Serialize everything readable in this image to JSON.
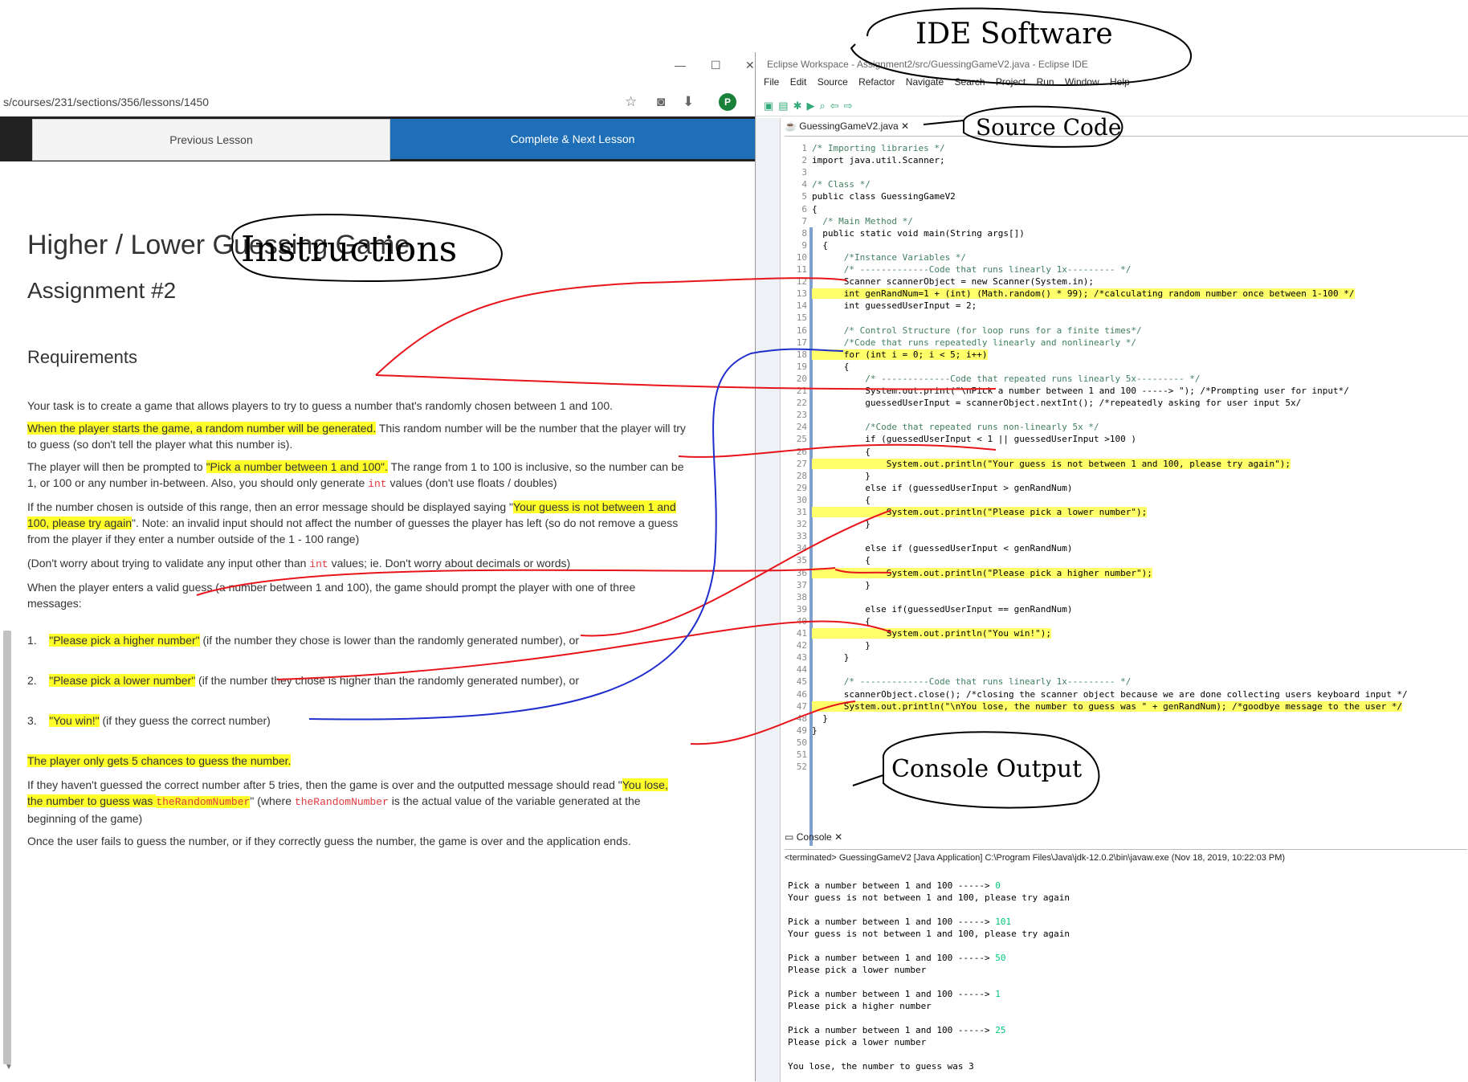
{
  "browser": {
    "window_controls": [
      "—",
      "☐",
      "✕"
    ],
    "url": "s/courses/231/sections/356/lessons/1450",
    "avatar_letter": "P",
    "prev_label": "Previous Lesson",
    "next_label": "Complete & Next Lesson"
  },
  "lesson": {
    "title": "Higher / Lower Guessing Game",
    "subtitle": "Assignment #2",
    "requirements": "Requirements",
    "p1": "Your task is to create a game that allows players to try to guess a number that's randomly chosen between 1 and 100.",
    "p2_hl": "When the player starts the game, a random number will be generated.",
    "p2_rest": " This random number will be the number that the player will try to guess (so don't tell the player what this number is).",
    "p3_a": "The player will then be prompted to ",
    "p3_hl": "\"Pick a number between 1 and 100\".",
    "p3_b": " The range from 1 to 100 is inclusive, so the number can be 1, or 100 or any number in-between. Also, you should only generate ",
    "p3_code": "int",
    "p3_c": " values (don't use floats / doubles)",
    "p4_a": "If the number chosen is outside of this range, then an error message should be displayed saying \"",
    "p4_hl": "Your guess is not between 1 and 100, please try again",
    "p4_b": "\". Note: an invalid input should not affect the number of guesses the player has left (so do not remove a guess from the player if they enter a number outside of the 1 - 100 range)",
    "p5_a": "(Don't worry about trying to validate any input other than ",
    "p5_code": "int",
    "p5_b": " values; ie. Don't worry about decimals or words)",
    "p6": "When the player enters a valid guess (a number between 1 and 100), the game should prompt the player with one of three messages:",
    "li1_num": "1.",
    "li1_hl": "\"Please pick a higher number\"",
    "li1_rest": " (if the number they chose is lower than the randomly generated number), or",
    "li2_num": "2.",
    "li2_hl": "\"Please pick a lower number\"",
    "li2_rest": " (if the number they chose is higher than the randomly generated number), or",
    "li3_num": "3.",
    "li3_hl": "\"You win!\"",
    "li3_rest": " (if they guess the correct number)",
    "p7_hl": "The player only gets 5 chances to guess the number.",
    "p8_a": "If they haven't guessed the correct number after 5 tries, then the game is over and the outputted message should read \"",
    "p8_hl1": "You lose, the number to guess was ",
    "p8_code": "theRandomNumber",
    "p8_b": "\" (where ",
    "p8_code2": "theRandomNumber",
    "p8_c": " is the actual value of the variable generated at the beginning of the game)",
    "p9": "Once the user fails to guess the number, or if they correctly guess the number, the game is over and the application ends."
  },
  "eclipse": {
    "title": "Eclipse Workspace - Assignment2/src/GuessingGameV2.java - Eclipse IDE",
    "menu": [
      "File",
      "Edit",
      "Source",
      "Refactor",
      "Navigate",
      "Search",
      "Project",
      "Run",
      "Window",
      "Help"
    ],
    "editor_tab": "GuessingGameV2.java",
    "console_tab": "Console",
    "console_header": "<terminated> GuessingGameV2 [Java Application] C:\\Program Files\\Java\\jdk-12.0.2\\bin\\javaw.exe (Nov 18, 2019, 10:22:03 PM)"
  },
  "code": [
    {
      "n": "1",
      "t": "/* Importing libraries */"
    },
    {
      "n": "2",
      "t": "import java.util.Scanner;"
    },
    {
      "n": "3",
      "t": ""
    },
    {
      "n": "4",
      "t": "/* Class */"
    },
    {
      "n": "5",
      "t": "public class GuessingGameV2"
    },
    {
      "n": "6",
      "t": "{"
    },
    {
      "n": "7",
      "t": "  /* Main Method */"
    },
    {
      "n": "8",
      "t": "  public static void main(String args[])"
    },
    {
      "n": "9",
      "t": "  {"
    },
    {
      "n": "10",
      "t": "      /*Instance Variables */"
    },
    {
      "n": "11",
      "t": "      /* -------------Code that runs linearly 1x--------- */"
    },
    {
      "n": "12",
      "t": "      Scanner scannerObject = new Scanner(System.in);"
    },
    {
      "n": "13",
      "t": "      int genRandNum=1 + (int) (Math.random() * 99); /*calculating random number once between 1-100 */"
    },
    {
      "n": "14",
      "t": "      int guessedUserInput = 2;"
    },
    {
      "n": "15",
      "t": ""
    },
    {
      "n": "16",
      "t": "      /* Control Structure (for loop runs for a finite times*/"
    },
    {
      "n": "17",
      "t": "      /*Code that runs repeatedly linearly and nonlinearly */"
    },
    {
      "n": "18",
      "t": "      for (int i = 0; i < 5; i++)"
    },
    {
      "n": "19",
      "t": "      {"
    },
    {
      "n": "20",
      "t": "          /* -------------Code that repeated runs linearly 5x--------- */"
    },
    {
      "n": "21",
      "t": "          System.out.print(\"\\nPick a number between 1 and 100 -----> \"); /*Prompting user for input*/"
    },
    {
      "n": "22",
      "t": "          guessedUserInput = scannerObject.nextInt(); /*repeatedly asking for user input 5x/"
    },
    {
      "n": "23",
      "t": ""
    },
    {
      "n": "24",
      "t": "          /*Code that repeated runs non-linearly 5x */"
    },
    {
      "n": "25",
      "t": "          if (guessedUserInput < 1 || guessedUserInput >100 )"
    },
    {
      "n": "26",
      "t": "          {"
    },
    {
      "n": "27",
      "t": "              System.out.println(\"Your guess is not between 1 and 100, please try again\");"
    },
    {
      "n": "28",
      "t": "          }"
    },
    {
      "n": "29",
      "t": "          else if (guessedUserInput > genRandNum)"
    },
    {
      "n": "30",
      "t": "          {"
    },
    {
      "n": "31",
      "t": "              System.out.println(\"Please pick a lower number\");"
    },
    {
      "n": "32",
      "t": "          }"
    },
    {
      "n": "33",
      "t": ""
    },
    {
      "n": "34",
      "t": "          else if (guessedUserInput < genRandNum)"
    },
    {
      "n": "35",
      "t": "          {"
    },
    {
      "n": "36",
      "t": "              System.out.println(\"Please pick a higher number\");"
    },
    {
      "n": "37",
      "t": "          }"
    },
    {
      "n": "38",
      "t": ""
    },
    {
      "n": "39",
      "t": "          else if(guessedUserInput == genRandNum)"
    },
    {
      "n": "40",
      "t": "          {"
    },
    {
      "n": "41",
      "t": "              System.out.println(\"You win!\");"
    },
    {
      "n": "42",
      "t": "          }"
    },
    {
      "n": "43",
      "t": "      }"
    },
    {
      "n": "44",
      "t": ""
    },
    {
      "n": "45",
      "t": "      /* -------------Code that runs linearly 1x--------- */"
    },
    {
      "n": "46",
      "t": "      scannerObject.close(); /*closing the scanner object because we are done collecting users keyboard input */"
    },
    {
      "n": "47",
      "t": "      System.out.println(\"\\nYou lose, the number to guess was \" + genRandNum); /*goodbye message to the user */"
    },
    {
      "n": "48",
      "t": "  }"
    },
    {
      "n": "49",
      "t": "}"
    },
    {
      "n": "50",
      "t": ""
    },
    {
      "n": "51",
      "t": ""
    },
    {
      "n": "52",
      "t": ""
    }
  ],
  "console": [
    {
      "p": "Pick a number between 1 and 100 -----> ",
      "v": "0"
    },
    {
      "p": "Your guess is not between 1 and 100, please try again",
      "v": ""
    },
    {
      "p": "",
      "v": ""
    },
    {
      "p": "Pick a number between 1 and 100 -----> ",
      "v": "101"
    },
    {
      "p": "Your guess is not between 1 and 100, please try again",
      "v": ""
    },
    {
      "p": "",
      "v": ""
    },
    {
      "p": "Pick a number between 1 and 100 -----> ",
      "v": "50"
    },
    {
      "p": "Please pick a lower number",
      "v": ""
    },
    {
      "p": "",
      "v": ""
    },
    {
      "p": "Pick a number between 1 and 100 -----> ",
      "v": "1"
    },
    {
      "p": "Please pick a higher number",
      "v": ""
    },
    {
      "p": "",
      "v": ""
    },
    {
      "p": "Pick a number between 1 and 100 -----> ",
      "v": "25"
    },
    {
      "p": "Please pick a lower number",
      "v": ""
    },
    {
      "p": "",
      "v": ""
    },
    {
      "p": "You lose, the number to guess was 3",
      "v": ""
    }
  ],
  "annotations": {
    "ide": "IDE Software",
    "source": "Source Code",
    "instructions": "Instructions",
    "console": "Console Output"
  }
}
